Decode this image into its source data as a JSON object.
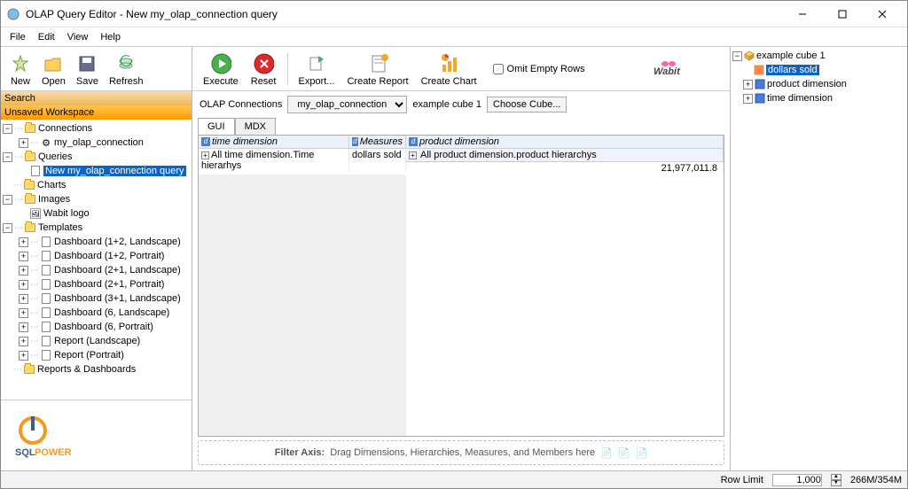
{
  "window": {
    "title": "OLAP Query Editor - New my_olap_connection query"
  },
  "menus": [
    "File",
    "Edit",
    "View",
    "Help"
  ],
  "left_toolbar": [
    {
      "label": "New"
    },
    {
      "label": "Open"
    },
    {
      "label": "Save"
    },
    {
      "label": "Refresh"
    }
  ],
  "search_label": "Search",
  "workspace_label": "Unsaved Workspace",
  "tree": {
    "connections": "Connections",
    "conn_item": "my_olap_connection",
    "queries": "Queries",
    "query_item": "New my_olap_connection query",
    "charts": "Charts",
    "images": "Images",
    "wabit_logo": "Wabit logo",
    "templates": "Templates",
    "template_items": [
      "Dashboard (1+2, Landscape)",
      "Dashboard (1+2, Portrait)",
      "Dashboard (2+1, Landscape)",
      "Dashboard (2+1, Portrait)",
      "Dashboard (3+1, Landscape)",
      "Dashboard (6, Landscape)",
      "Dashboard (6, Portrait)",
      "Report (Landscape)",
      "Report (Portrait)"
    ],
    "reports": "Reports & Dashboards"
  },
  "center_toolbar": {
    "execute": "Execute",
    "reset": "Reset",
    "export": "Export...",
    "create_report": "Create Report",
    "create_chart": "Create Chart",
    "omit": "Omit Empty Rows"
  },
  "brand": "Wabit",
  "conn_row": {
    "label": "OLAP Connections",
    "selected": "my_olap_connection",
    "cube": "example cube 1",
    "choose": "Choose Cube..."
  },
  "tabs": {
    "gui": "GUI",
    "mdx": "MDX"
  },
  "grid": {
    "time_dim": "time dimension",
    "measures": "Measures",
    "product_dim": "product dimension",
    "time_row": "All time dimension.Time hierarhys",
    "dollars": "dollars sold",
    "product_row": "All product dimension.product hierarchys",
    "value": "21,977,011.8"
  },
  "filter_label": "Filter Axis:",
  "filter_hint": "Drag Dimensions, Hierarchies, Measures, and Members here",
  "right_tree": {
    "cube": "example cube 1",
    "dollars": "dollars sold",
    "product": "product dimension",
    "time": "time dimension"
  },
  "status": {
    "row_limit_label": "Row Limit",
    "row_limit_value": "1,000",
    "mem": "266M/354M"
  },
  "logo": "SQLPOWER"
}
